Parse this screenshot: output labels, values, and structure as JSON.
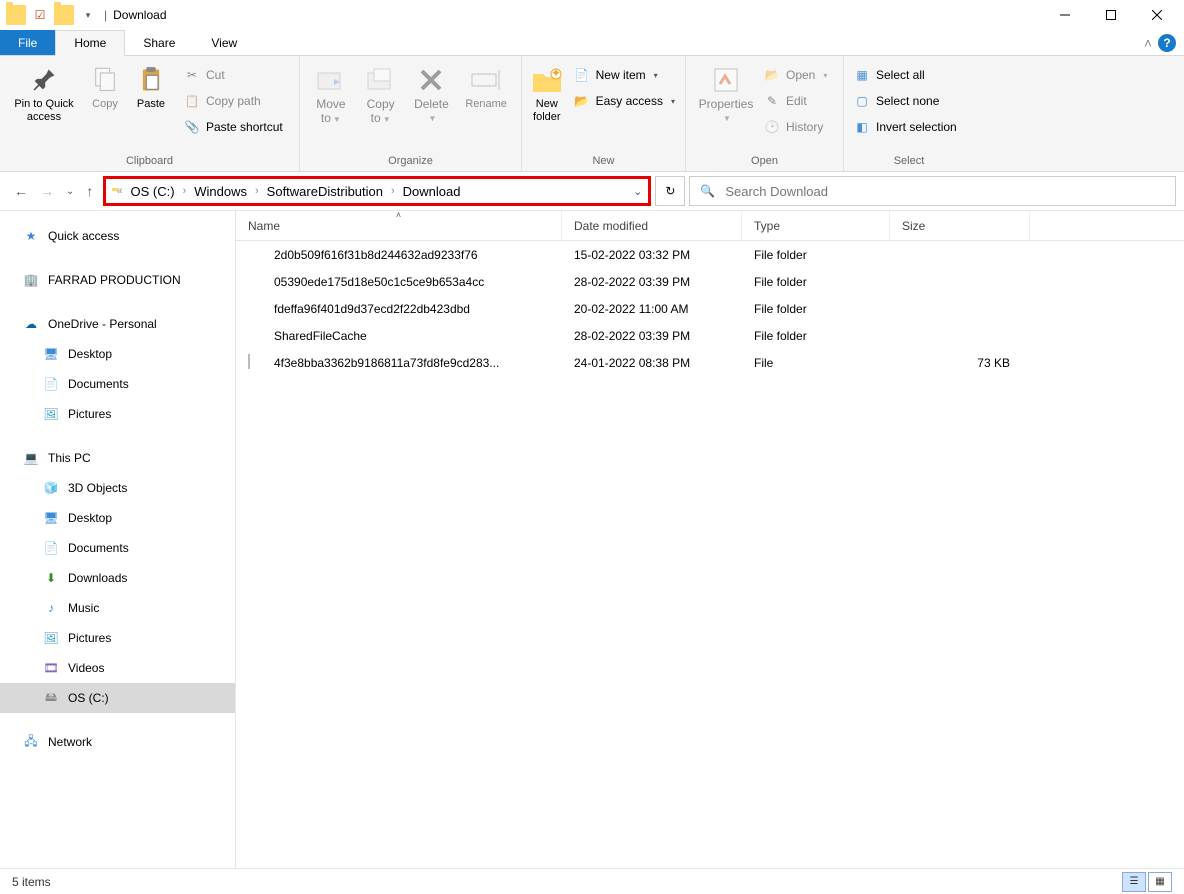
{
  "window": {
    "title": "Download"
  },
  "tabs": {
    "file": "File",
    "home": "Home",
    "share": "Share",
    "view": "View"
  },
  "ribbon": {
    "clipboard": {
      "label": "Clipboard",
      "pin": "Pin to Quick\naccess",
      "copy": "Copy",
      "paste": "Paste",
      "cut": "Cut",
      "copy_path": "Copy path",
      "paste_shortcut": "Paste shortcut"
    },
    "organize": {
      "label": "Organize",
      "move_to": "Move\nto",
      "copy_to": "Copy\nto",
      "delete": "Delete",
      "rename": "Rename"
    },
    "new": {
      "label": "New",
      "new_folder": "New\nfolder",
      "new_item": "New item",
      "easy_access": "Easy access"
    },
    "open": {
      "label": "Open",
      "properties": "Properties",
      "open": "Open",
      "edit": "Edit",
      "history": "History"
    },
    "select": {
      "label": "Select",
      "select_all": "Select all",
      "select_none": "Select none",
      "invert": "Invert selection"
    }
  },
  "breadcrumb": {
    "parts": [
      "OS (C:)",
      "Windows",
      "SoftwareDistribution",
      "Download"
    ]
  },
  "search": {
    "placeholder": "Search Download"
  },
  "columns": {
    "name": "Name",
    "date": "Date modified",
    "type": "Type",
    "size": "Size"
  },
  "sidebar": {
    "quick_access": "Quick access",
    "farrad": "FARRAD PRODUCTION",
    "onedrive": "OneDrive - Personal",
    "od_desktop": "Desktop",
    "od_documents": "Documents",
    "od_pictures": "Pictures",
    "this_pc": "This PC",
    "pc_3d": "3D Objects",
    "pc_desktop": "Desktop",
    "pc_documents": "Documents",
    "pc_downloads": "Downloads",
    "pc_music": "Music",
    "pc_pictures": "Pictures",
    "pc_videos": "Videos",
    "pc_os": "OS (C:)",
    "network": "Network"
  },
  "files": [
    {
      "name": "2d0b509f616f31b8d244632ad9233f76",
      "date": "15-02-2022 03:32 PM",
      "type": "File folder",
      "size": "",
      "icon": "folder"
    },
    {
      "name": "05390ede175d18e50c1c5ce9b653a4cc",
      "date": "28-02-2022 03:39 PM",
      "type": "File folder",
      "size": "",
      "icon": "folder"
    },
    {
      "name": "fdeffa96f401d9d37ecd2f22db423dbd",
      "date": "20-02-2022 11:00 AM",
      "type": "File folder",
      "size": "",
      "icon": "folder"
    },
    {
      "name": "SharedFileCache",
      "date": "28-02-2022 03:39 PM",
      "type": "File folder",
      "size": "",
      "icon": "folder"
    },
    {
      "name": "4f3e8bba3362b9186811a73fd8fe9cd283...",
      "date": "24-01-2022 08:38 PM",
      "type": "File",
      "size": "73 KB",
      "icon": "file"
    }
  ],
  "status": {
    "items": "5 items"
  }
}
